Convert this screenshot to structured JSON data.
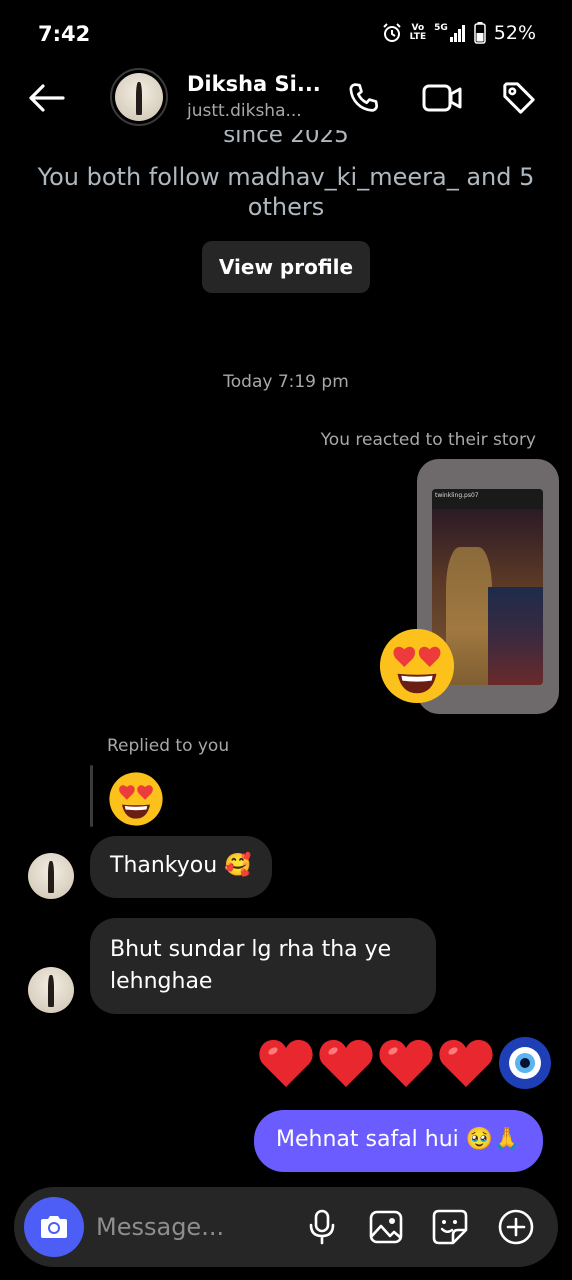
{
  "status_bar": {
    "time": "7:42",
    "network_top": "Vo",
    "network_bottom": "LTE",
    "signal_label": "5G",
    "battery": "52%"
  },
  "header": {
    "name": "Diksha Si...",
    "username": "justt.diksha..."
  },
  "profile_info": {
    "since": "since 2025",
    "mutual": "You both follow madhav_ki_meera_ and 5 others",
    "view_profile_label": "View profile"
  },
  "conversation": {
    "timestamp": "Today 7:19 pm",
    "reacted_label": "You reacted to their story",
    "story_handle": "twinkling.ps07",
    "story_reaction": "😍",
    "replied_label": "Replied to you",
    "reply_quote_emoji": "😍",
    "messages": [
      {
        "sender": "them",
        "text": "Thankyou 🥰"
      },
      {
        "sender": "them",
        "text": "Bhut sundar lg rha tha ye lehnghae"
      },
      {
        "sender": "me",
        "text": "❤️❤️❤️❤️🧿"
      },
      {
        "sender": "me",
        "text": "Mehnat safal hui 🥹🙏"
      }
    ]
  },
  "composer": {
    "placeholder": "Message..."
  },
  "colors": {
    "background": "#000000",
    "incoming_bubble": "#262626",
    "outgoing_bubble": "#6b5cff",
    "camera_button": "#4d5ef6",
    "secondary_text": "#a8a8a8"
  }
}
